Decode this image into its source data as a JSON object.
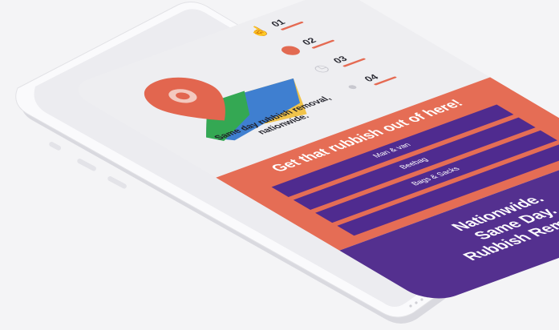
{
  "steps": [
    {
      "number": "01",
      "icon": "hand-icon"
    },
    {
      "number": "02",
      "icon": "person-pin-icon"
    },
    {
      "number": "03",
      "icon": "clock-icon"
    },
    {
      "number": "04",
      "icon": "chat-icon"
    }
  ],
  "hero": {
    "caption": "Same day rubbish removal, nationwide.",
    "pin_color": "#e2664f",
    "map_colors": [
      "#34a853",
      "#3f7fd0",
      "#f0c34a"
    ]
  },
  "cta": {
    "headline": "Get that rubbish out of here!",
    "options": [
      "Man & van",
      "Beebag",
      "Bags & Sacks",
      ""
    ]
  },
  "footer": {
    "lines": [
      "Nationwide.",
      "Same Day.",
      "Rubbish Removal."
    ]
  },
  "colors": {
    "accent": "#e56d55",
    "purple": "#54308f",
    "option_bg": "#4f2b8f"
  }
}
